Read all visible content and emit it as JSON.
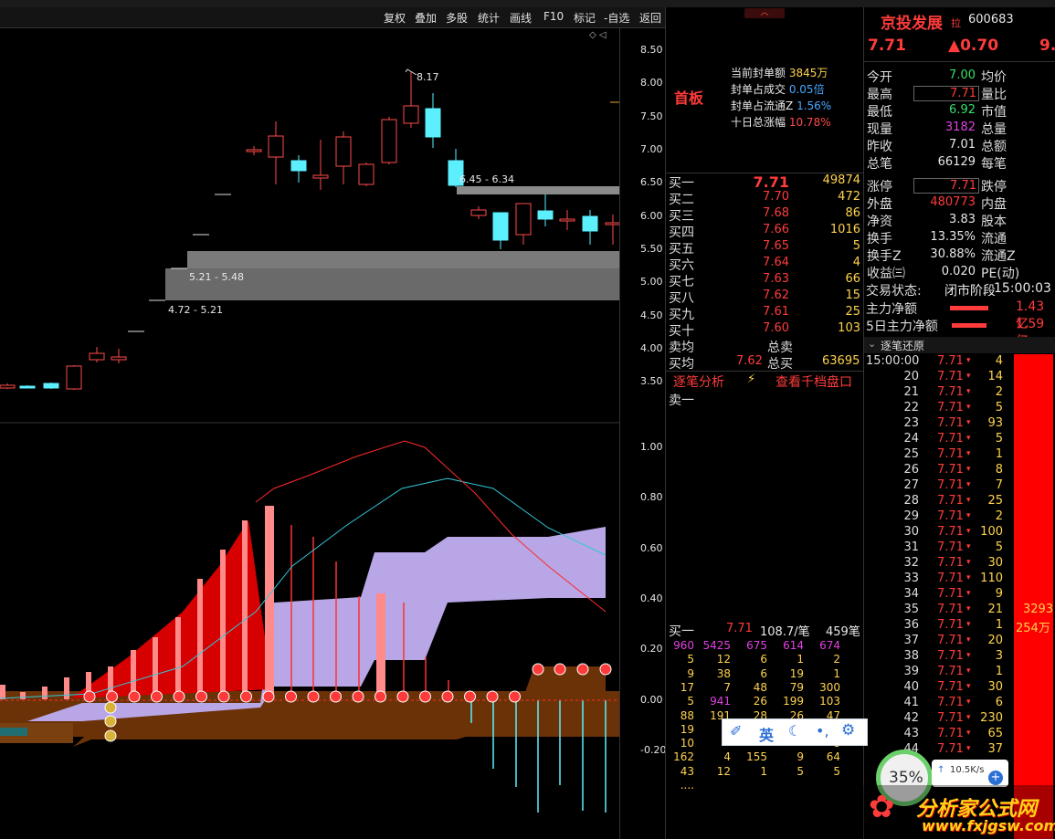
{
  "toolbar": [
    "复权",
    "叠加",
    "多股",
    "统计",
    "画线",
    "F10",
    "标记",
    "-自选",
    "返回"
  ],
  "price_axis": [
    "8.50",
    "8.00",
    "7.50",
    "7.00",
    "6.50",
    "6.00",
    "5.50",
    "5.00",
    "4.50",
    "4.00",
    "3.50"
  ],
  "ind_axis": [
    "1.00",
    "0.80",
    "0.60",
    "0.40",
    "0.20",
    "0.00",
    "-0.20"
  ],
  "chart_labels": {
    "high": "8.17",
    "zone1": "6.45 - 6.34",
    "zone2": "5.21 - 5.48",
    "zone3": "4.72 - 5.21"
  },
  "limit_board": {
    "tag": "首板",
    "lines": [
      {
        "k": "当前封单额",
        "v": "3845万"
      },
      {
        "k": "封单占成交",
        "v": "0.05倍"
      },
      {
        "k": "封单占流通Z",
        "v": "1.56%"
      },
      {
        "k": "十日总涨幅",
        "v": "10.78%"
      }
    ]
  },
  "orderbook": [
    {
      "n": "买一",
      "p": "7.71",
      "v": "49874"
    },
    {
      "n": "买二",
      "p": "7.70",
      "v": "472"
    },
    {
      "n": "买三",
      "p": "7.68",
      "v": "86"
    },
    {
      "n": "买四",
      "p": "7.66",
      "v": "1016"
    },
    {
      "n": "买五",
      "p": "7.65",
      "v": "5"
    },
    {
      "n": "买六",
      "p": "7.64",
      "v": "4"
    },
    {
      "n": "买七",
      "p": "7.63",
      "v": "66"
    },
    {
      "n": "买八",
      "p": "7.62",
      "v": "15"
    },
    {
      "n": "买九",
      "p": "7.61",
      "v": "25"
    },
    {
      "n": "买十",
      "p": "7.60",
      "v": "103"
    }
  ],
  "avg": {
    "sell_label": "卖均",
    "total_sell": "总卖",
    "buy_label": "买均",
    "buy_avg": "7.62",
    "total_buy": "总买",
    "total_buy_v": "63695"
  },
  "links": {
    "analysis": "逐笔分析",
    "thousand": "查看千档盘口",
    "sell1": "卖一"
  },
  "queue": {
    "head": {
      "n": "买一",
      "p": "7.71",
      "per": "108.7/笔",
      "cnt": "459笔"
    },
    "rows": [
      [
        "960",
        "5425",
        "675",
        "614",
        "674"
      ],
      [
        "5",
        "12",
        "6",
        "1",
        "2"
      ],
      [
        "9",
        "38",
        "6",
        "19",
        "1"
      ],
      [
        "17",
        "7",
        "48",
        "79",
        "300"
      ],
      [
        "5",
        "941",
        "26",
        "199",
        "103"
      ],
      [
        "88",
        "191",
        "28",
        "26",
        "47"
      ],
      [
        "19",
        "",
        "",
        "",
        "4"
      ],
      [
        "10",
        "",
        "",
        "",
        "8"
      ],
      [
        "162",
        "4",
        "155",
        "9",
        "64"
      ],
      [
        "43",
        "12",
        "1",
        "5",
        "5"
      ],
      [
        "....",
        "",
        "",
        "",
        ""
      ]
    ]
  },
  "stock": {
    "name": "京投发展",
    "tag": "拉",
    "code": "600683",
    "price": "7.71",
    "change": "▲0.70",
    "pct": "9."
  },
  "quote_left": [
    {
      "k": "今开",
      "v": "7.00",
      "c": "grn"
    },
    {
      "k": "最高",
      "v": "7.71",
      "c": "red"
    },
    {
      "k": "最低",
      "v": "6.92",
      "c": "grn"
    },
    {
      "k": "现量",
      "v": "3182",
      "c": "mag"
    },
    {
      "k": "昨收",
      "v": "7.01",
      "c": "wht"
    },
    {
      "k": "总笔",
      "v": "66129",
      "c": "wht"
    },
    {
      "k": "涨停",
      "v": "7.71",
      "c": "red"
    },
    {
      "k": "外盘",
      "v": "480773",
      "c": "red"
    },
    {
      "k": "净资",
      "v": "3.83",
      "c": "wht"
    },
    {
      "k": "换手",
      "v": "13.35%",
      "c": "wht"
    },
    {
      "k": "换手Z",
      "v": "30.88%",
      "c": "wht"
    },
    {
      "k": "收益㈢",
      "v": "0.020",
      "c": "wht"
    }
  ],
  "quote_right": [
    "均价",
    "量比",
    "市值",
    "总量",
    "总额",
    "每笔",
    "跌停",
    "内盘",
    "股本",
    "流通",
    "流通Z",
    "PE(动)"
  ],
  "trade_state": {
    "k": "交易状态:",
    "v": "闭市阶段",
    "t": "15:00:03"
  },
  "flows": [
    {
      "k": "主力净额",
      "v": "1.43亿"
    },
    {
      "k": "5日主力净额",
      "v": "1.59亿"
    }
  ],
  "ticks_header": "逐笔还原",
  "ticks": [
    {
      "t": "15:00:00",
      "p": "7.71",
      "v": "4"
    },
    {
      "t": "20",
      "p": "7.71",
      "v": "14"
    },
    {
      "t": "21",
      "p": "7.71",
      "v": "2"
    },
    {
      "t": "22",
      "p": "7.71",
      "v": "5"
    },
    {
      "t": "23",
      "p": "7.71",
      "v": "93"
    },
    {
      "t": "24",
      "p": "7.71",
      "v": "5"
    },
    {
      "t": "25",
      "p": "7.71",
      "v": "1"
    },
    {
      "t": "26",
      "p": "7.71",
      "v": "8"
    },
    {
      "t": "27",
      "p": "7.71",
      "v": "7"
    },
    {
      "t": "28",
      "p": "7.71",
      "v": "25"
    },
    {
      "t": "29",
      "p": "7.71",
      "v": "2"
    },
    {
      "t": "30",
      "p": "7.71",
      "v": "100"
    },
    {
      "t": "31",
      "p": "7.71",
      "v": "5"
    },
    {
      "t": "32",
      "p": "7.71",
      "v": "30"
    },
    {
      "t": "33",
      "p": "7.71",
      "v": "110"
    },
    {
      "t": "34",
      "p": "7.71",
      "v": "9"
    },
    {
      "t": "35",
      "p": "7.71",
      "v": "21"
    },
    {
      "t": "36",
      "p": "7.71",
      "v": "1"
    },
    {
      "t": "37",
      "p": "7.71",
      "v": "20"
    },
    {
      "t": "38",
      "p": "7.71",
      "v": "3"
    },
    {
      "t": "39",
      "p": "7.71",
      "v": "1"
    },
    {
      "t": "40",
      "p": "7.71",
      "v": "30"
    },
    {
      "t": "41",
      "p": "7.71",
      "v": "6"
    },
    {
      "t": "42",
      "p": "7.71",
      "v": "230"
    },
    {
      "t": "43",
      "p": "7.71",
      "v": "65"
    },
    {
      "t": "44",
      "p": "7.71",
      "v": "37"
    }
  ],
  "side_bar": {
    "v1": "3293",
    "v2": "254万"
  },
  "ime": [
    "英"
  ],
  "net": {
    "pct": "35%",
    "speed": "10.5K/s"
  },
  "watermark": {
    "brand": "分析家公式网",
    "url": "www.fxjgsw.com"
  }
}
